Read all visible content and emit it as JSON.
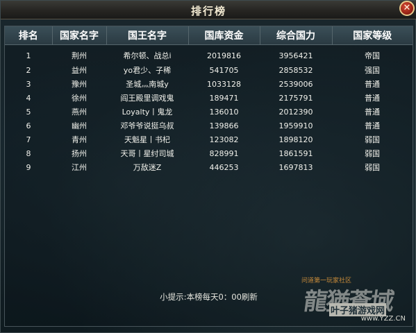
{
  "window": {
    "title": "排行榜",
    "close_symbol": "✕"
  },
  "table": {
    "headers": [
      "排名",
      "国家名字",
      "国王名字",
      "国库资金",
      "综合国力",
      "国家等级"
    ],
    "rows": [
      [
        "1",
        "荆州",
        "希尔顿、战总i",
        "2019816",
        "3956421",
        "帝国"
      ],
      [
        "2",
        "益州",
        "yo君少、子稀",
        "541705",
        "2858532",
        "强国"
      ],
      [
        "3",
        "豫州",
        "圣城灬南城y",
        "1033128",
        "2539006",
        "普通"
      ],
      [
        "4",
        "徐州",
        "阎王殿里调戏鬼",
        "189471",
        "2175791",
        "普通"
      ],
      [
        "5",
        "燕州",
        "Loyalty丨鬼龙",
        "136010",
        "2012390",
        "普通"
      ],
      [
        "6",
        "幽州",
        "邓爷爷说挺乌叔",
        "139866",
        "1959910",
        "普通"
      ],
      [
        "7",
        "青州",
        "天魁星丨书杞",
        "123082",
        "1898120",
        "弱国"
      ],
      [
        "8",
        "扬州",
        "天哥丨星纣司城",
        "828991",
        "1861591",
        "弱国"
      ],
      [
        "9",
        "江州",
        "万敌迷Z",
        "446253",
        "1697813",
        "弱国"
      ]
    ]
  },
  "hint": "小提示:本榜每天0：00刷新",
  "watermark": {
    "tagline": "问道第一玩家社区",
    "logo_text": "龍猶蒼域",
    "badge": "叶子猪",
    "badge2": "游戏网",
    "site": "www.YZZ.CN"
  }
}
